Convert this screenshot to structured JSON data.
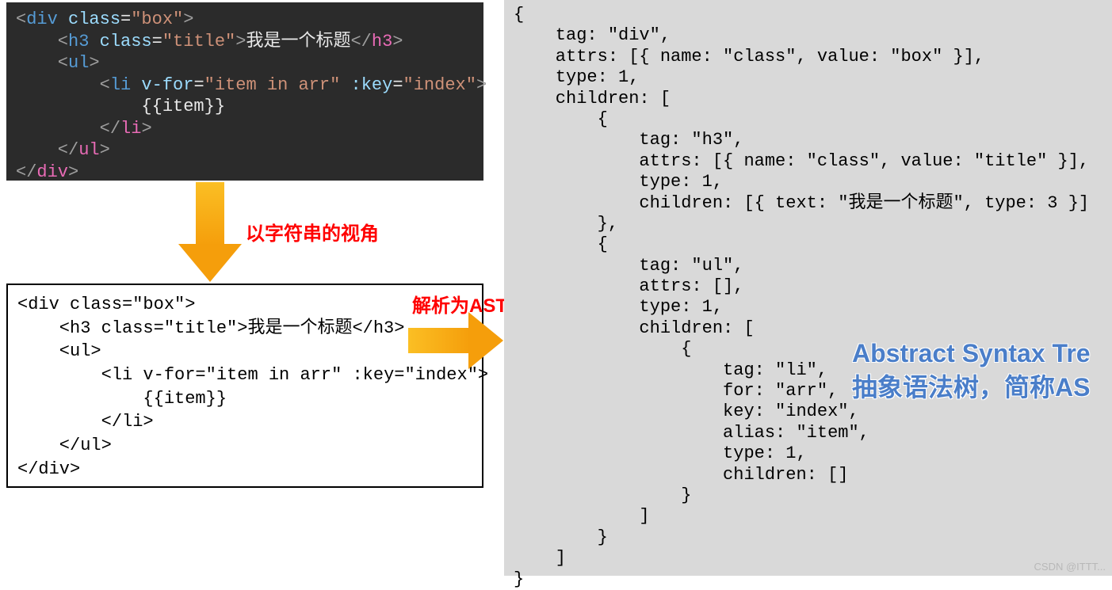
{
  "dark_code": {
    "l1a": "<",
    "l1b": "div",
    "l1c": " class",
    "l1d": "=",
    "l1e": "\"box\"",
    "l1f": ">",
    "l2a": "    <",
    "l2b": "h3",
    "l2c": " class",
    "l2d": "=",
    "l2e": "\"title\"",
    "l2f": ">",
    "l2g": "我是一个标题",
    "l2h": "</",
    "l2i": "h3",
    "l2j": ">",
    "l3a": "    <",
    "l3b": "ul",
    "l3c": ">",
    "l4a": "        <",
    "l4b": "li",
    "l4c": " v-for",
    "l4d": "=",
    "l4e": "\"item in arr\"",
    "l4f": " :key",
    "l4g": "=",
    "l4h": "\"index\"",
    "l4i": ">",
    "l5": "            {{item}}",
    "l6a": "        </",
    "l6b": "li",
    "l6c": ">",
    "l7a": "    </",
    "l7b": "ul",
    "l7c": ">",
    "l8a": "</",
    "l8b": "div",
    "l8c": ">"
  },
  "label1": "以字符串的视角",
  "plain_code": "<div class=\"box\">\n    <h3 class=\"title\">我是一个标题</h3>\n    <ul>\n        <li v-for=\"item in arr\" :key=\"index\">\n            {{item}}\n        </li>\n    </ul>\n</div>",
  "label2": "解析为AST",
  "ast_code": "{\n    tag: \"div\",\n    attrs: [{ name: \"class\", value: \"box\" }],\n    type: 1,\n    children: [\n        {\n            tag: \"h3\",\n            attrs: [{ name: \"class\", value: \"title\" }],\n            type: 1,\n            children: [{ text: \"我是一个标题\", type: 3 }]\n        },\n        {\n            tag: \"ul\",\n            attrs: [],\n            type: 1,\n            children: [\n                {\n                    tag: \"li\",\n                    for: \"arr\",\n                    key: \"index\",\n                    alias: \"item\",\n                    type: 1,\n                    children: []\n                }\n            ]\n        }\n    ]\n}",
  "ast_title": "Abstract Syntax Tre\n抽象语法树，简称AS",
  "watermark": "CSDN @ITTT..."
}
